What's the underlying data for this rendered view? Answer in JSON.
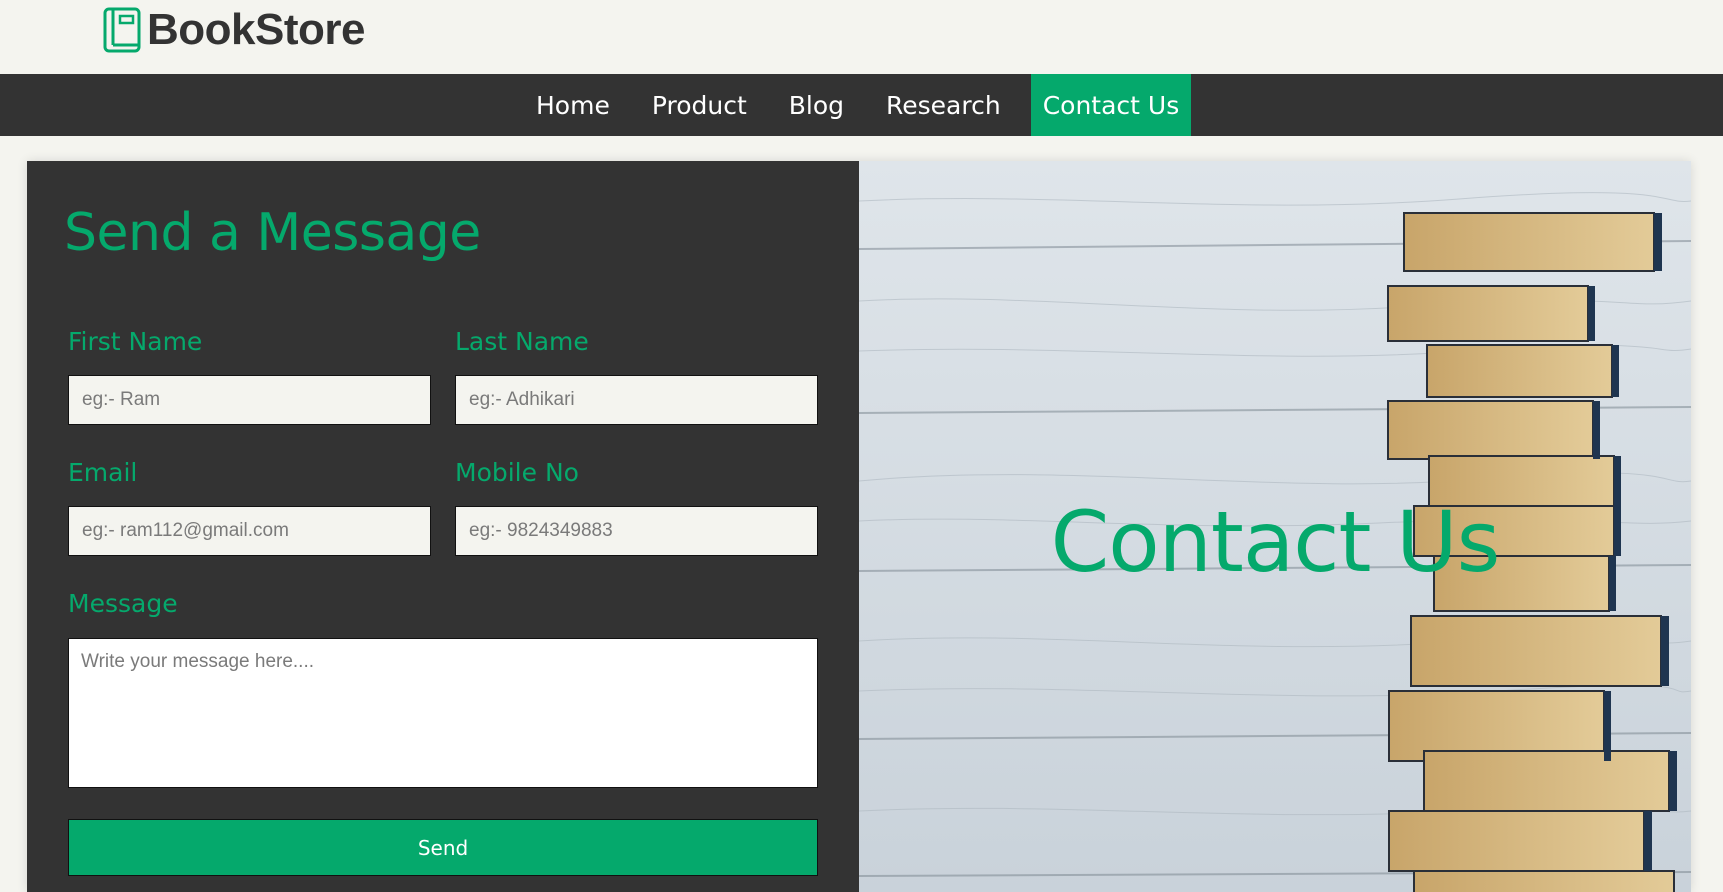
{
  "header": {
    "logo_text": "BookStore",
    "logo_icon": "book-icon"
  },
  "nav": {
    "items": [
      {
        "label": "Home"
      },
      {
        "label": "Product"
      },
      {
        "label": "Blog"
      },
      {
        "label": "Research"
      },
      {
        "label": "Contact Us",
        "active": true
      }
    ]
  },
  "form": {
    "title": "Send a Message",
    "first_name": {
      "label": "First Name",
      "placeholder": "eg:- Ram"
    },
    "last_name": {
      "label": "Last Name",
      "placeholder": "eg:- Adhikari"
    },
    "email": {
      "label": "Email",
      "placeholder": "eg:- ram112@gmail.com"
    },
    "mobile": {
      "label": "Mobile No",
      "placeholder": "eg:- 9824349883"
    },
    "message": {
      "label": "Message",
      "placeholder": "Write your message here...."
    },
    "send_label": "Send"
  },
  "hero": {
    "title": "Contact Us"
  },
  "colors": {
    "accent": "#05a96c",
    "dark": "#333333",
    "light_bg": "#f4f4ef"
  }
}
